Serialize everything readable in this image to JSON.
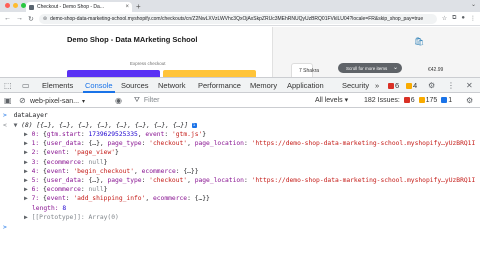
{
  "browser": {
    "tab_title": "Checkout - Demo Shop - Da...",
    "url": "demo-shop-data-marketing-school.myshopify.com/checkouts/cn/Z2NwLXVzLWVhc3QxOjAxSkpZRUc3MEhRNUQyUzBRQ01FVklLU04?locale=FR&skip_shop_pay=true"
  },
  "page": {
    "shop_title": "Demo Shop - Data MArketing School",
    "express_checkout": "Express checkout",
    "product_name": "7 Shakra",
    "product_price": "€42.99",
    "tooltip": "Scroll for more items",
    "colors": {
      "shop_pay": "#5a31f4",
      "paypal": "#ffc439"
    }
  },
  "devtools": {
    "tabs": [
      "Elements",
      "Console",
      "Sources",
      "Network",
      "Performance",
      "Memory",
      "Application",
      "Security"
    ],
    "active_tab": "Console",
    "more_tabs": "»",
    "tab_errors": "6",
    "tab_warnings": "4",
    "context": "web-pixel-san...",
    "filter_placeholder": "Filter",
    "levels": "All levels ▾",
    "issues_label": "182 Issues:",
    "issues_errors": "6",
    "issues_warnings": "175",
    "issues_info": "1"
  },
  "console": {
    "input": "dataLayer",
    "header": "(8) [{…}, {…}, {…}, {…}, {…}, {…}, {…}, {…}]",
    "items": [
      {
        "index": "0:",
        "body": "{gtm.start: 1739629525335, event: 'gtm.js'}"
      },
      {
        "index": "1:",
        "body": "{user_data: {…}, page_type: 'checkout', page_location: 'https://demo-shop-data-marketing-school.myshopify…yUzBRQ1I"
      },
      {
        "index": "2:",
        "body": "{event: 'page_view'}"
      },
      {
        "index": "3:",
        "body": "{ecommerce: null}"
      },
      {
        "index": "4:",
        "body": "{event: 'begin_checkout', ecommerce: {…}}"
      },
      {
        "index": "5:",
        "body": "{user_data: {…}, page_type: 'checkout', page_location: 'https://demo-shop-data-marketing-school.myshopify…yUzBRQ1I"
      },
      {
        "index": "6:",
        "body": "{ecommerce: null}"
      },
      {
        "index": "7:",
        "body": "{event: 'add_shipping_info', ecommerce: {…}}"
      }
    ],
    "length_label": "length:",
    "length_value": "8",
    "prototype": "[[Prototype]]: Array(0)"
  }
}
